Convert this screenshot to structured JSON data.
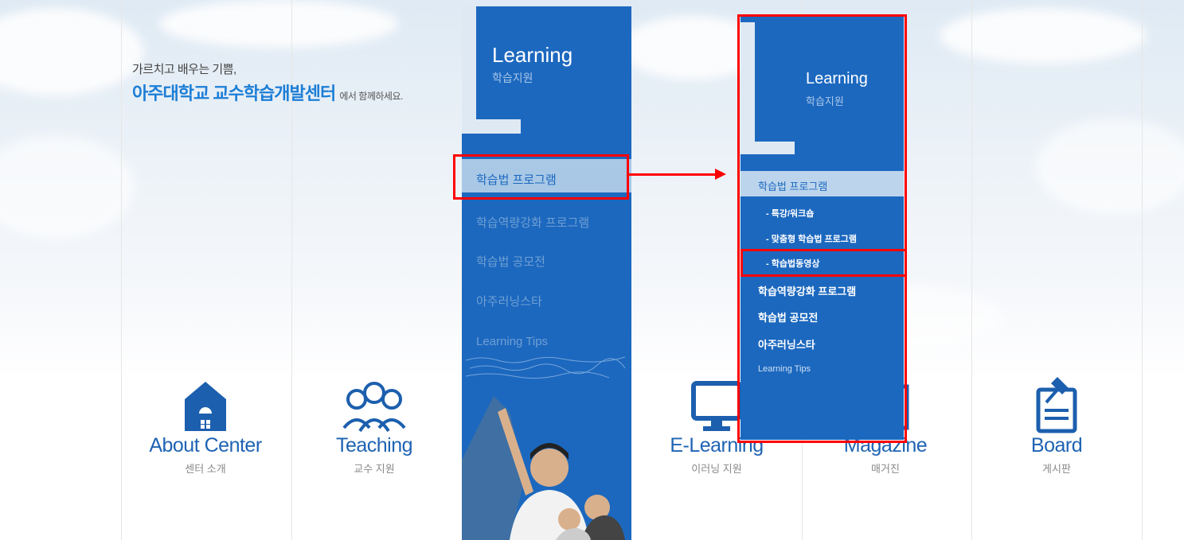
{
  "tagline": {
    "line1": "가르치고 배우는 기쁨,",
    "school": "아주대학교",
    "center": "교수학습개발센터",
    "suffix": "에서 함께하세요."
  },
  "nav": [
    {
      "en": "About Center",
      "ko": "센터 소개",
      "icon": "house-icon"
    },
    {
      "en": "Teaching",
      "ko": "교수 지원",
      "icon": "people-icon"
    },
    {
      "en": "E-Learning",
      "ko": "이러닝 지원",
      "icon": "monitor-icon"
    },
    {
      "en": "Magazine",
      "ko": "매거진",
      "icon": "magazine-icon"
    },
    {
      "en": "Board",
      "ko": "게시판",
      "icon": "clipboard-icon"
    }
  ],
  "learning_panel": {
    "title": "Learning",
    "subtitle": "학습지원",
    "menu": [
      "학습법 프로그램",
      "학습역량강화 프로그램",
      "학습법 공모전",
      "아주러닝스타",
      "Learning Tips"
    ]
  },
  "expanded_panel": {
    "title": "Learning",
    "subtitle": "학습지원",
    "active": "학습법 프로그램",
    "submenu": [
      "- 특강/워크숍",
      "- 맞춤형 학습법 프로그램",
      "- 학습법동영상"
    ],
    "menu": [
      "학습역량강화 프로그램",
      "학습법 공모전",
      "아주러닝스타",
      "Learning Tips"
    ]
  },
  "colors": {
    "panel_blue": "#1c68bf",
    "highlight": "#ff0000",
    "nav_text": "#1e63b3"
  }
}
